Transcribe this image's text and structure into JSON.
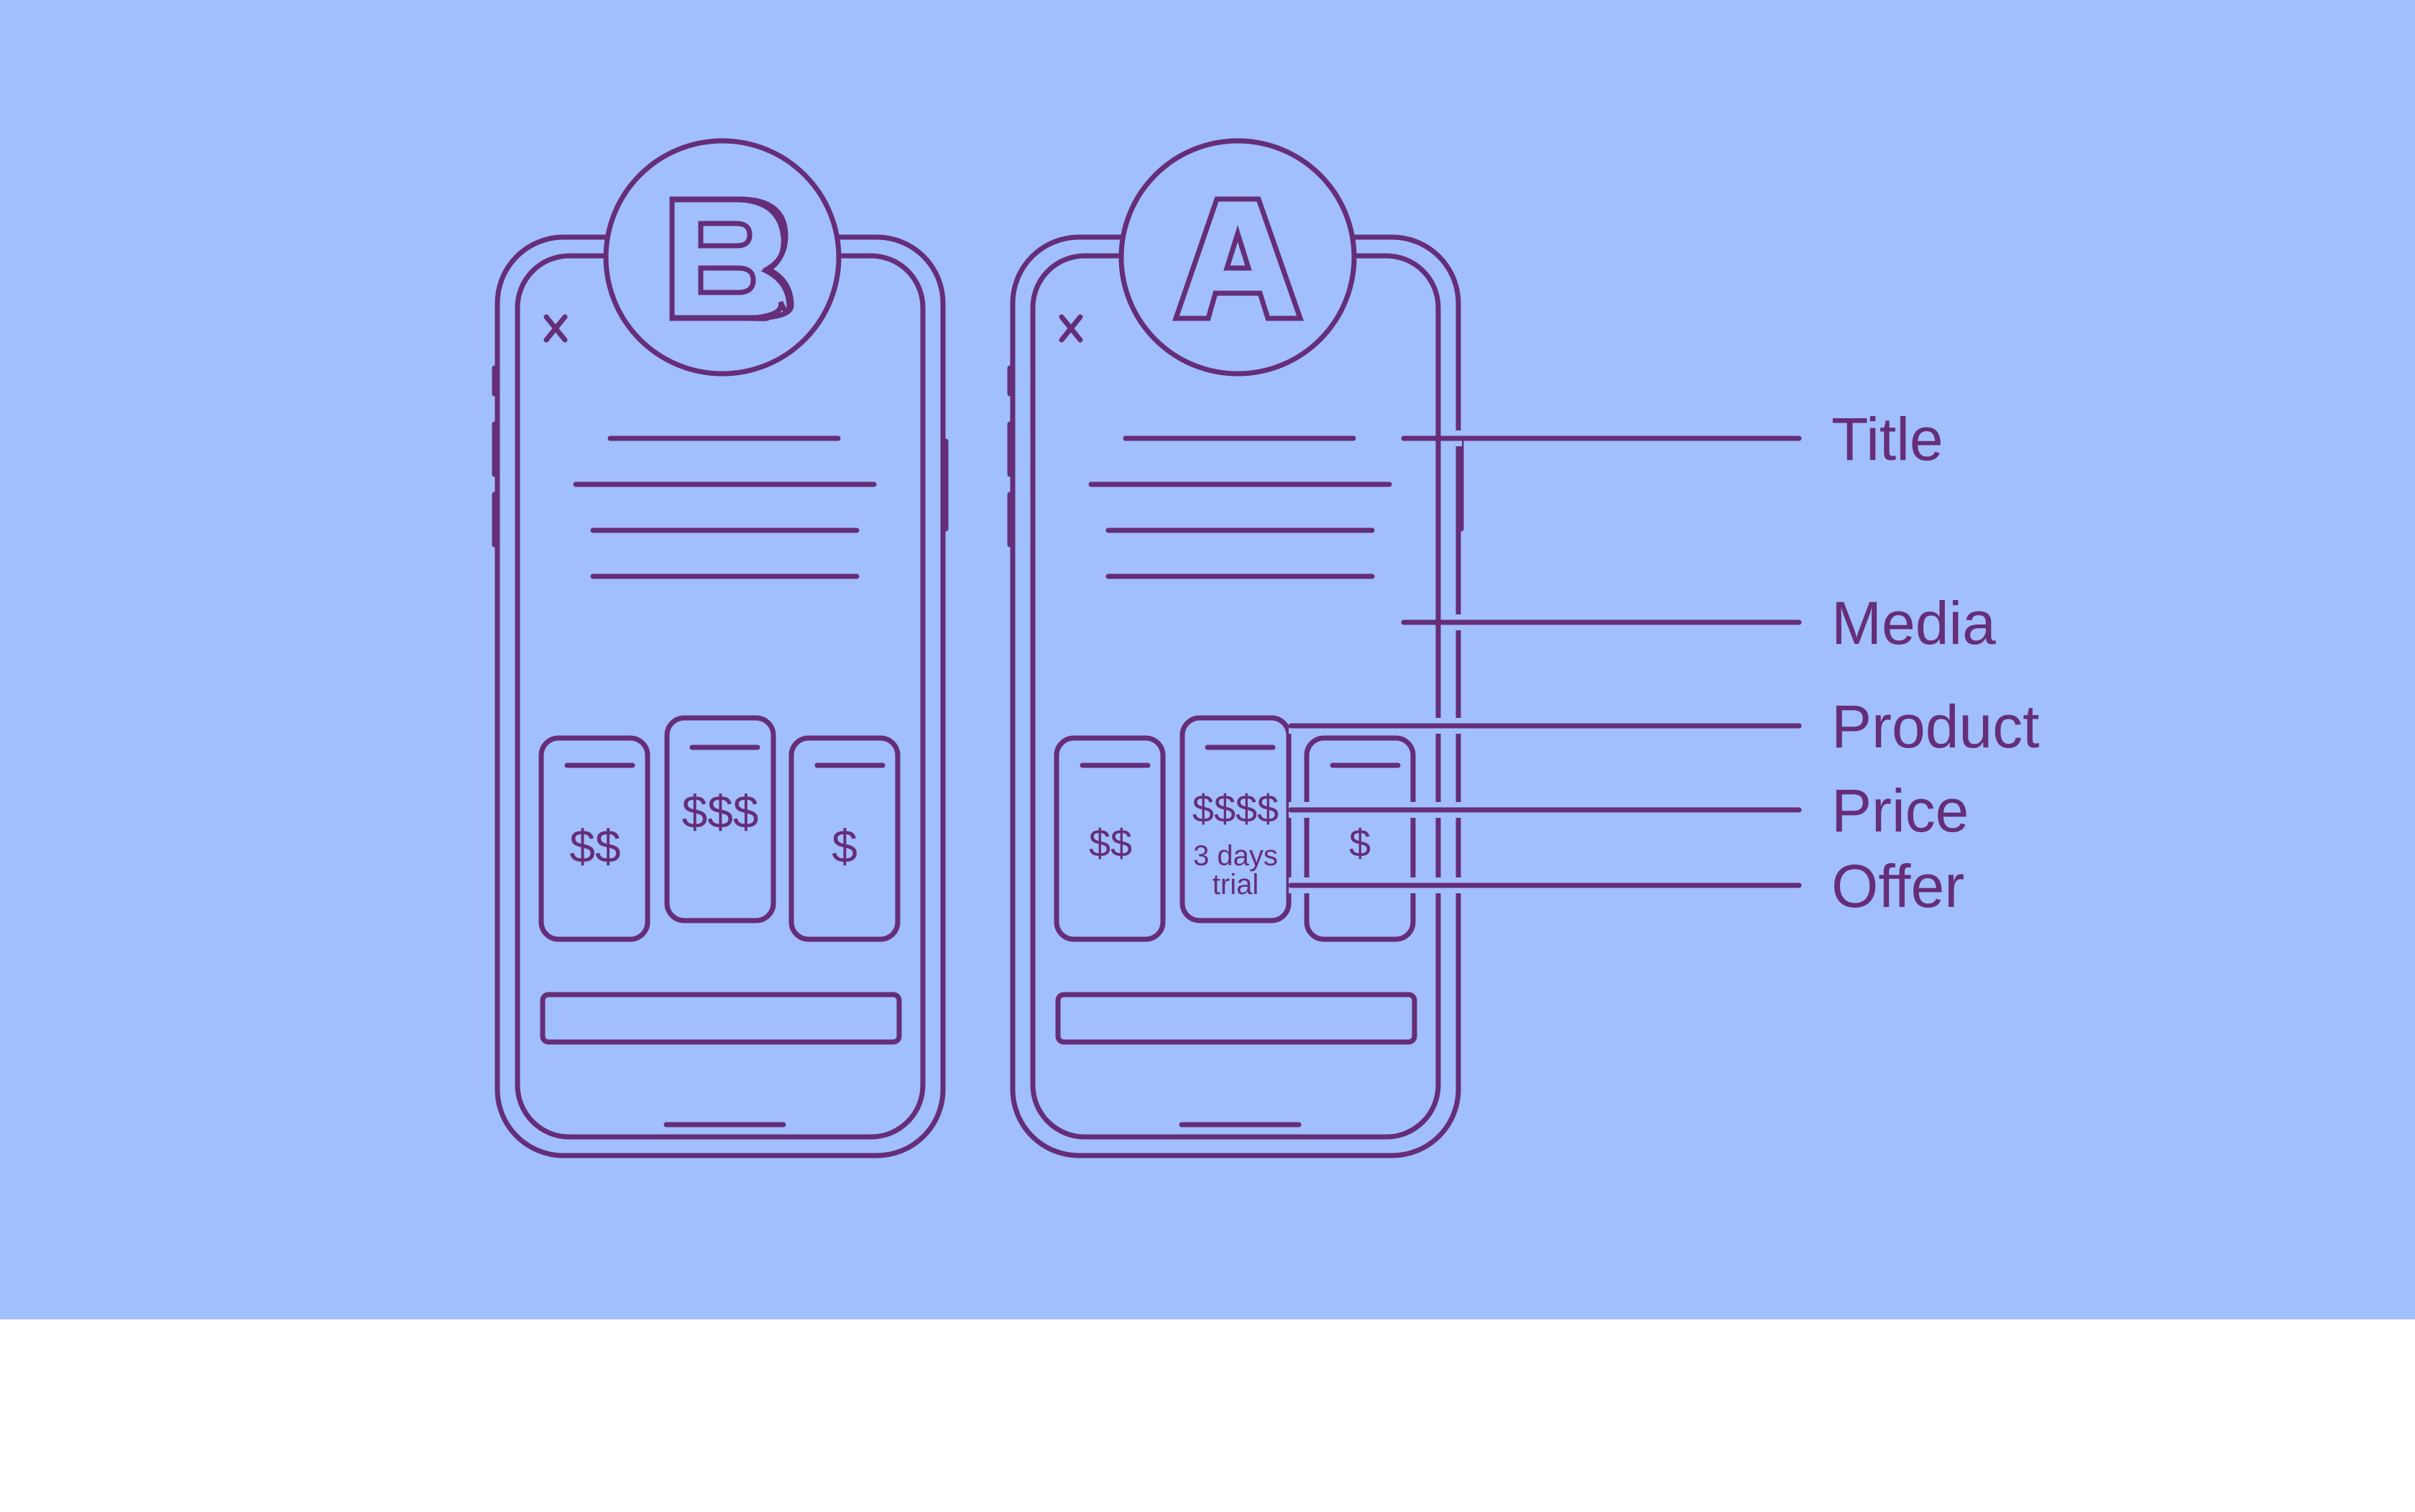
{
  "colors": {
    "background": "#a0bffc",
    "stroke": "#662d78",
    "page": "#ffffff"
  },
  "variants": [
    {
      "id": "B",
      "badge_letter": "B",
      "close_icon": "close-icon",
      "products": [
        {
          "price": "$$",
          "offer": ""
        },
        {
          "price": "$$$",
          "offer": "",
          "highlighted": true
        },
        {
          "price": "$",
          "offer": ""
        }
      ]
    },
    {
      "id": "A",
      "badge_letter": "A",
      "close_icon": "close-icon",
      "products": [
        {
          "price": "$$",
          "offer": ""
        },
        {
          "price": "$$$$",
          "offer_line1": "3 days",
          "offer_line2": "trial",
          "highlighted": true
        },
        {
          "price": "$",
          "offer": ""
        }
      ]
    }
  ],
  "annotations": [
    {
      "label": "Title"
    },
    {
      "label": "Media"
    },
    {
      "label": "Product"
    },
    {
      "label": "Price"
    },
    {
      "label": "Offer"
    }
  ]
}
